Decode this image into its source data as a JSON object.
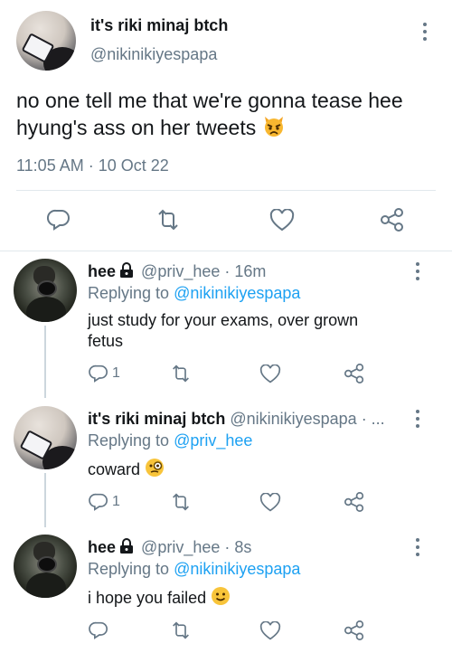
{
  "main_tweet": {
    "display_name": "it's riki minaj btch",
    "handle": "@nikinikiyespapa",
    "text": "no one tell me that we're gonna tease hee hyung's ass on her tweets",
    "emoji_icon": "pouting-cat-emoji",
    "timestamp": "11:05 AM · 10 Oct 22"
  },
  "replies": [
    {
      "display_name": "hee",
      "protected": true,
      "handle_time": "@priv_hee · 16m",
      "replying_prefix": "Replying to",
      "replying_to": "@nikinikiyespapa",
      "text": "just study for your exams, over grown fetus",
      "reply_count": "1"
    },
    {
      "display_name": "it's riki minaj btch",
      "protected": false,
      "handle_time": "@nikinikiyespapa · ...",
      "replying_prefix": "Replying to",
      "replying_to": "@priv_hee",
      "text": "coward",
      "emoji_icon": "face-with-monocle-emoji",
      "reply_count": "1"
    },
    {
      "display_name": "hee",
      "protected": true,
      "handle_time": "@priv_hee · 8s",
      "replying_prefix": "Replying to",
      "replying_to": "@nikinikiyespapa",
      "text": "i hope you failed",
      "emoji_icon": "slightly-smiling-face-emoji",
      "reply_count": ""
    }
  ],
  "colors": {
    "link": "#1da1f2",
    "secondary_text": "#657786",
    "primary_text": "#14171a",
    "divider": "#e1e8ed"
  },
  "icons": [
    "more-icon",
    "reply-icon",
    "retweet-icon",
    "like-icon",
    "share-icon",
    "lock-icon"
  ]
}
